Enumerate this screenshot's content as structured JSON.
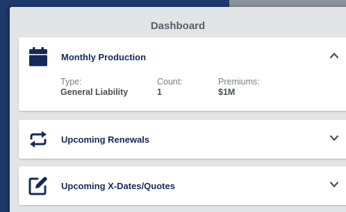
{
  "panel": {
    "title": "Dashboard"
  },
  "cards": {
    "monthly": {
      "title": "Monthly Production",
      "icon": "calendar-icon",
      "expanded": true,
      "stats": [
        {
          "label": "Type:",
          "value": "General Liability"
        },
        {
          "label": "Count:",
          "value": "1"
        },
        {
          "label": "Premiums:",
          "value": "$1M"
        }
      ]
    },
    "renewals": {
      "title": "Upcoming Renewals",
      "icon": "renew-arrows-icon",
      "expanded": false
    },
    "xdates": {
      "title": "Upcoming X-Dates/Quotes",
      "icon": "edit-icon",
      "expanded": false
    }
  },
  "colors": {
    "navy": "#14295a",
    "background": "#1e3a6a",
    "panel": "#e3e4e6"
  }
}
